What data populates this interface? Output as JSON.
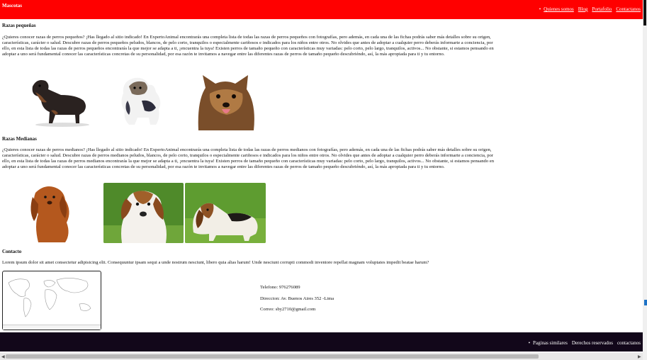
{
  "header": {
    "brand": "Mascotas",
    "nav": [
      "Quienes somos",
      "Blog",
      "Portafolio",
      "Contactanos"
    ]
  },
  "sections": {
    "small": {
      "title": "Razas pequeñas",
      "text": "¿Quieres conocer razas de perros pequeños? ¡Has llegado al sitio indicado! En ExpertoAnimal encontrarás una completa lista de todas las razas de perros pequeños con fotografías, pero además, en cada una de las fichas podrás saber más detalles sobre su origen, características, carácter o salud. Descubre razas de perros pequeños peludos, blancos, de pelo corto, tranquilos o especialmente cariñosos e indicados para los niños entre otros. No olvides que antes de adoptar a cualquier perro deberás informarte a conciencia, por ello, en esta lista de todas las razas de perros pequeños encontrarás la que mejor se adapta a ti, ¡encuentra la tuya! Existen perros de tamaño pequeño con características muy variadas: pelo corto, pelo largo, tranquilos, activos... No obstante, si estamos pensando en adoptar a uno será fundamental conocer las características concretas de su personalidad, por esa razón te invitamos a navegar entre las diferentes razas de perros de tamaño pequeño descubriéndo, así, la más apropiada para ti y tu entorno."
    },
    "medium": {
      "title": "Razas Medianas",
      "text": "¿Quieres conocer razas de perros medianos? ¡Has llegado al sitio indicado! En ExpertoAnimal encontrarás una completa lista de todas las razas de perros medianos con fotografías, pero además, en cada una de las fichas podrás saber más detalles sobre su origen, características, carácter o salud. Descubre razas de perros medianos peludos, blancos, de pelo corto, tranquilos o especialmente cariñosos e indicados para los niños entre otros. No olvides que antes de adoptar a cualquier perro deberás informarte a conciencia, por ello, en esta lista de todas las razas de perros medianos encontrarás la que mejor se adapta a ti, ¡encuentra la tuya! Existen perros de tamaño pequeño con características muy variadas: pelo corto, pelo largo, tranquilos, activos... No obstante, si estamos pensando en adoptar a uno será fundamental conocer las características concretas de su personalidad, por esa razón te invitamos a navegar entre las diferentes razas de perros de tamaño pequeño descubriéndo, así, la más apropiada para ti y tu entorno."
    },
    "contact": {
      "title": "Contacto",
      "text": "Lorem ipsum dolor sit amet consectetur adipisicing elit. Consequuntur ipsam sequi a unde nostrum nesciunt, libero quia alias harum! Unde nesciunt corrupti commodi inventore repellat magnam voluptates impedit beatae harum?"
    }
  },
  "contact_info": {
    "phone": "Telefono: 976276089",
    "address": "Direccion: Av. Buenos Aires 352 -Lima",
    "email": "Correo: sby2710@gmail.com"
  },
  "footer": {
    "nav": [
      "Paginas similares",
      "Derechos reservados",
      "contactanos"
    ]
  },
  "colors": {
    "header_bg": "#ff0000",
    "footer_bg": "#12071a"
  }
}
